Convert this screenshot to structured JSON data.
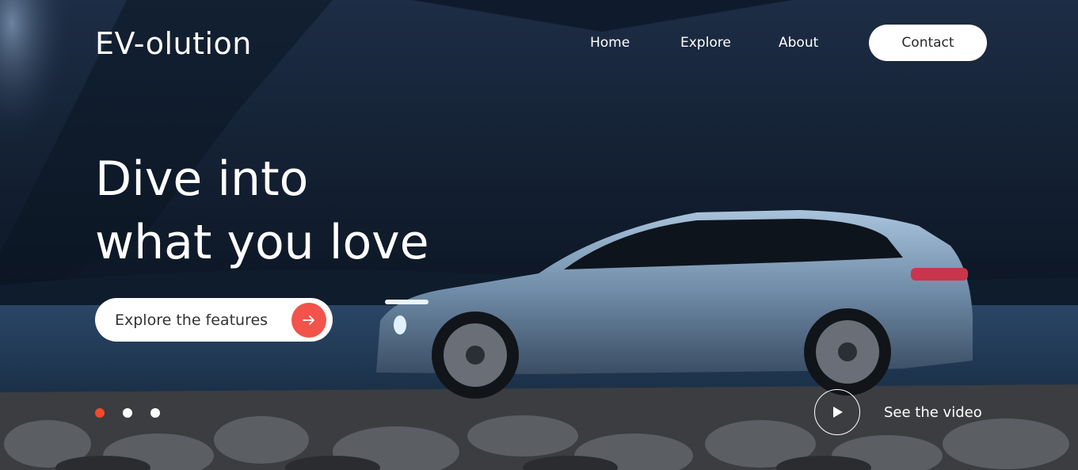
{
  "brand": {
    "logo_text": "EV-olution"
  },
  "nav": {
    "items": [
      {
        "label": "Home"
      },
      {
        "label": "Explore"
      },
      {
        "label": "About"
      }
    ],
    "contact_label": "Contact"
  },
  "hero": {
    "headline_line1": "Dive into",
    "headline_line2": "what you love",
    "cta_label": "Explore the features",
    "cta_icon": "arrow-right-icon"
  },
  "slider": {
    "dot_count": 3,
    "active_index": 0
  },
  "video": {
    "label": "See the video",
    "icon": "play-icon"
  },
  "colors": {
    "accent": "#f2534a",
    "active_dot": "#f24a2a",
    "text_light": "#ffffff"
  }
}
